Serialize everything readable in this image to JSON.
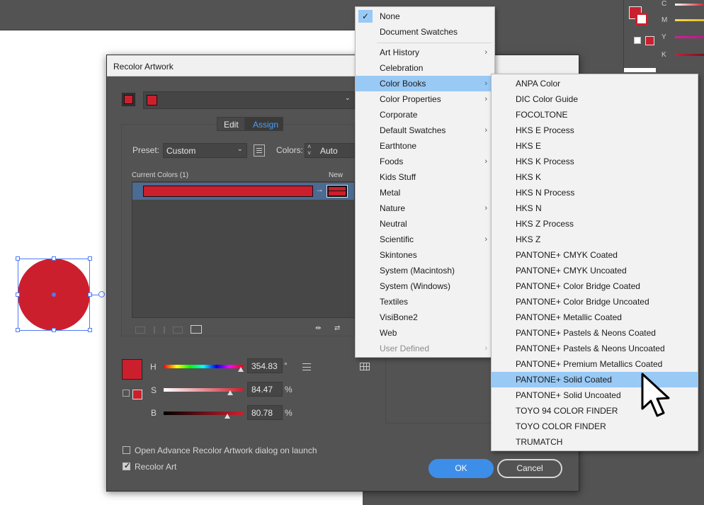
{
  "dialog": {
    "title": "Recolor Artwork",
    "tabs": [
      "Edit",
      "Assign"
    ],
    "active_tab": "Assign",
    "preset_label": "Preset:",
    "preset_value": "Custom",
    "colors_label": "Colors:",
    "colors_value": "Auto",
    "current_colors_label": "Current Colors (1)",
    "new_label": "New",
    "hsb": {
      "h_label": "H",
      "h_value": "354.83",
      "h_unit": "°",
      "s_label": "S",
      "s_value": "84.47",
      "s_unit": "%",
      "b_label": "B",
      "b_value": "80.78",
      "b_unit": "%"
    },
    "checkbox_advance": {
      "label": "Open Advance Recolor Artwork dialog on launch",
      "checked": false
    },
    "checkbox_recolor": {
      "label": "Recolor Art",
      "checked": true
    },
    "ok_label": "OK",
    "cancel_label": "Cancel"
  },
  "color_panel": {
    "labels": [
      "C",
      "M",
      "Y",
      "K"
    ]
  },
  "menu": {
    "items": [
      {
        "label": "None",
        "checked": true,
        "submenu": false
      },
      {
        "label": "Document Swatches",
        "submenu": false
      },
      {
        "label": "Art History",
        "submenu": true
      },
      {
        "label": "Celebration",
        "submenu": false
      },
      {
        "label": "Color Books",
        "submenu": true,
        "highlighted": true
      },
      {
        "label": "Color Properties",
        "submenu": true
      },
      {
        "label": "Corporate",
        "submenu": false
      },
      {
        "label": "Default Swatches",
        "submenu": true
      },
      {
        "label": "Earthtone",
        "submenu": false
      },
      {
        "label": "Foods",
        "submenu": true
      },
      {
        "label": "Kids Stuff",
        "submenu": false
      },
      {
        "label": "Metal",
        "submenu": false
      },
      {
        "label": "Nature",
        "submenu": true
      },
      {
        "label": "Neutral",
        "submenu": false
      },
      {
        "label": "Scientific",
        "submenu": true
      },
      {
        "label": "Skintones",
        "submenu": false
      },
      {
        "label": "System (Macintosh)",
        "submenu": false
      },
      {
        "label": "System (Windows)",
        "submenu": false
      },
      {
        "label": "Textiles",
        "submenu": false
      },
      {
        "label": "VisiBone2",
        "submenu": false
      },
      {
        "label": "Web",
        "submenu": false
      },
      {
        "label": "User Defined",
        "submenu": true,
        "disabled": true
      }
    ]
  },
  "submenu": {
    "items": [
      "ANPA Color",
      "DIC Color Guide",
      "FOCOLTONE",
      "HKS E Process",
      "HKS E",
      "HKS K Process",
      "HKS K",
      "HKS N Process",
      "HKS N",
      "HKS Z Process",
      "HKS Z",
      "PANTONE+ CMYK Coated",
      "PANTONE+ CMYK Uncoated",
      "PANTONE+ Color Bridge Coated",
      "PANTONE+ Color Bridge Uncoated",
      "PANTONE+ Metallic Coated",
      "PANTONE+ Pastels & Neons Coated",
      "PANTONE+ Pastels & Neons Uncoated",
      "PANTONE+ Premium Metallics Coated",
      "PANTONE+ Solid Coated",
      "PANTONE+ Solid Uncoated",
      "TOYO 94 COLOR FINDER",
      "TOYO COLOR FINDER",
      "TRUMATCH"
    ],
    "highlighted": "PANTONE+ Solid Coated"
  },
  "colors": {
    "swatch_red": "#cc1f2e",
    "highlight": "#99c9f5",
    "accent_blue": "#3d8ee9"
  }
}
